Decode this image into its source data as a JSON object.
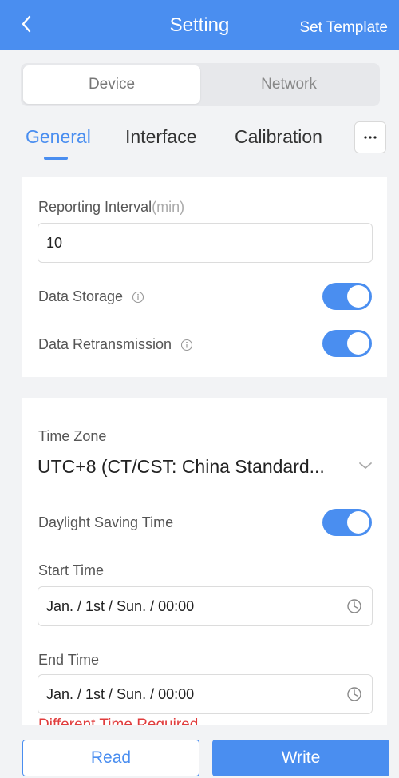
{
  "header": {
    "back_icon": "chevron-left-icon",
    "title": "Setting",
    "action": "Set Template"
  },
  "segment": {
    "device": "Device",
    "network": "Network",
    "selected": "Device"
  },
  "tabs": [
    {
      "label": "General",
      "active": true
    },
    {
      "label": "Interface",
      "active": false
    },
    {
      "label": "Calibration",
      "active": false
    }
  ],
  "more_label": "···",
  "general": {
    "reporting_interval_label": "Reporting Interval",
    "reporting_interval_unit": "(min)",
    "reporting_interval_value": "10",
    "data_storage_label": "Data Storage",
    "data_storage_on": true,
    "data_retransmission_label": "Data Retransmission",
    "data_retransmission_on": true
  },
  "time": {
    "time_zone_label": "Time Zone",
    "time_zone_value": "UTC+8 (CT/CST: China Standard...",
    "dst_label": "Daylight Saving Time",
    "dst_on": true,
    "start_time_label": "Start Time",
    "start_time_value": "Jan. / 1st / Sun. / 00:00",
    "end_time_label": "End Time",
    "end_time_value": "Jan. / 1st / Sun. / 00:00",
    "error_text": "Different Time Required"
  },
  "footer": {
    "read_label": "Read",
    "write_label": "Write"
  },
  "colors": {
    "accent": "#4a8ef0",
    "background": "#f2f3f5",
    "error": "#e03c3c"
  }
}
